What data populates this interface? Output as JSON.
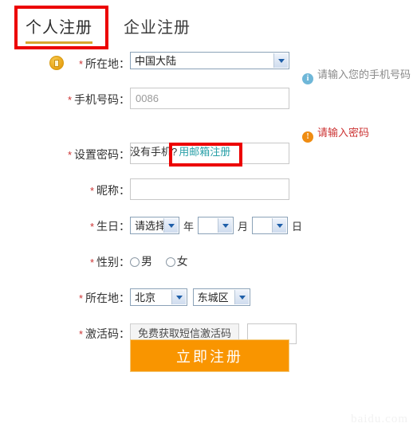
{
  "tabs": {
    "personal": "个人注册",
    "enterprise": "企业注册"
  },
  "form": {
    "region": {
      "label": "所在地：",
      "value": "中国大陆"
    },
    "phone": {
      "label": "手机号码：",
      "placeholder": "0086",
      "value": ""
    },
    "subnote": {
      "text": "没有手机?",
      "link": "用邮箱注册"
    },
    "password": {
      "label": "设置密码：",
      "value": ""
    },
    "nickname": {
      "label": "昵称：",
      "value": ""
    },
    "birthday": {
      "label": "生日：",
      "year": "请选择",
      "year_unit": "年",
      "month": "",
      "month_unit": "月",
      "day": "",
      "day_unit": "日"
    },
    "gender": {
      "label": "性别：",
      "male": "男",
      "female": "女"
    },
    "location": {
      "label": "所在地：",
      "province": "北京",
      "city": "东城区"
    },
    "activation": {
      "label": "激活码：",
      "button": "免费获取短信激活码",
      "value": ""
    },
    "submit": "立即注册"
  },
  "hints": {
    "phone": "请输入您的手机号码",
    "password": "请输入密码",
    "info_glyph": "i",
    "warn_glyph": "!"
  },
  "watermark": "baidu.com",
  "colors": {
    "accent_orange": "#f99500",
    "tab_underline": "#d9a62e",
    "annotation_red": "#ec0000",
    "link_teal": "#2aa0a8",
    "required_star": "#cc3333",
    "hint_info": "#6fb7d8",
    "hint_warn": "#ef8c12"
  }
}
